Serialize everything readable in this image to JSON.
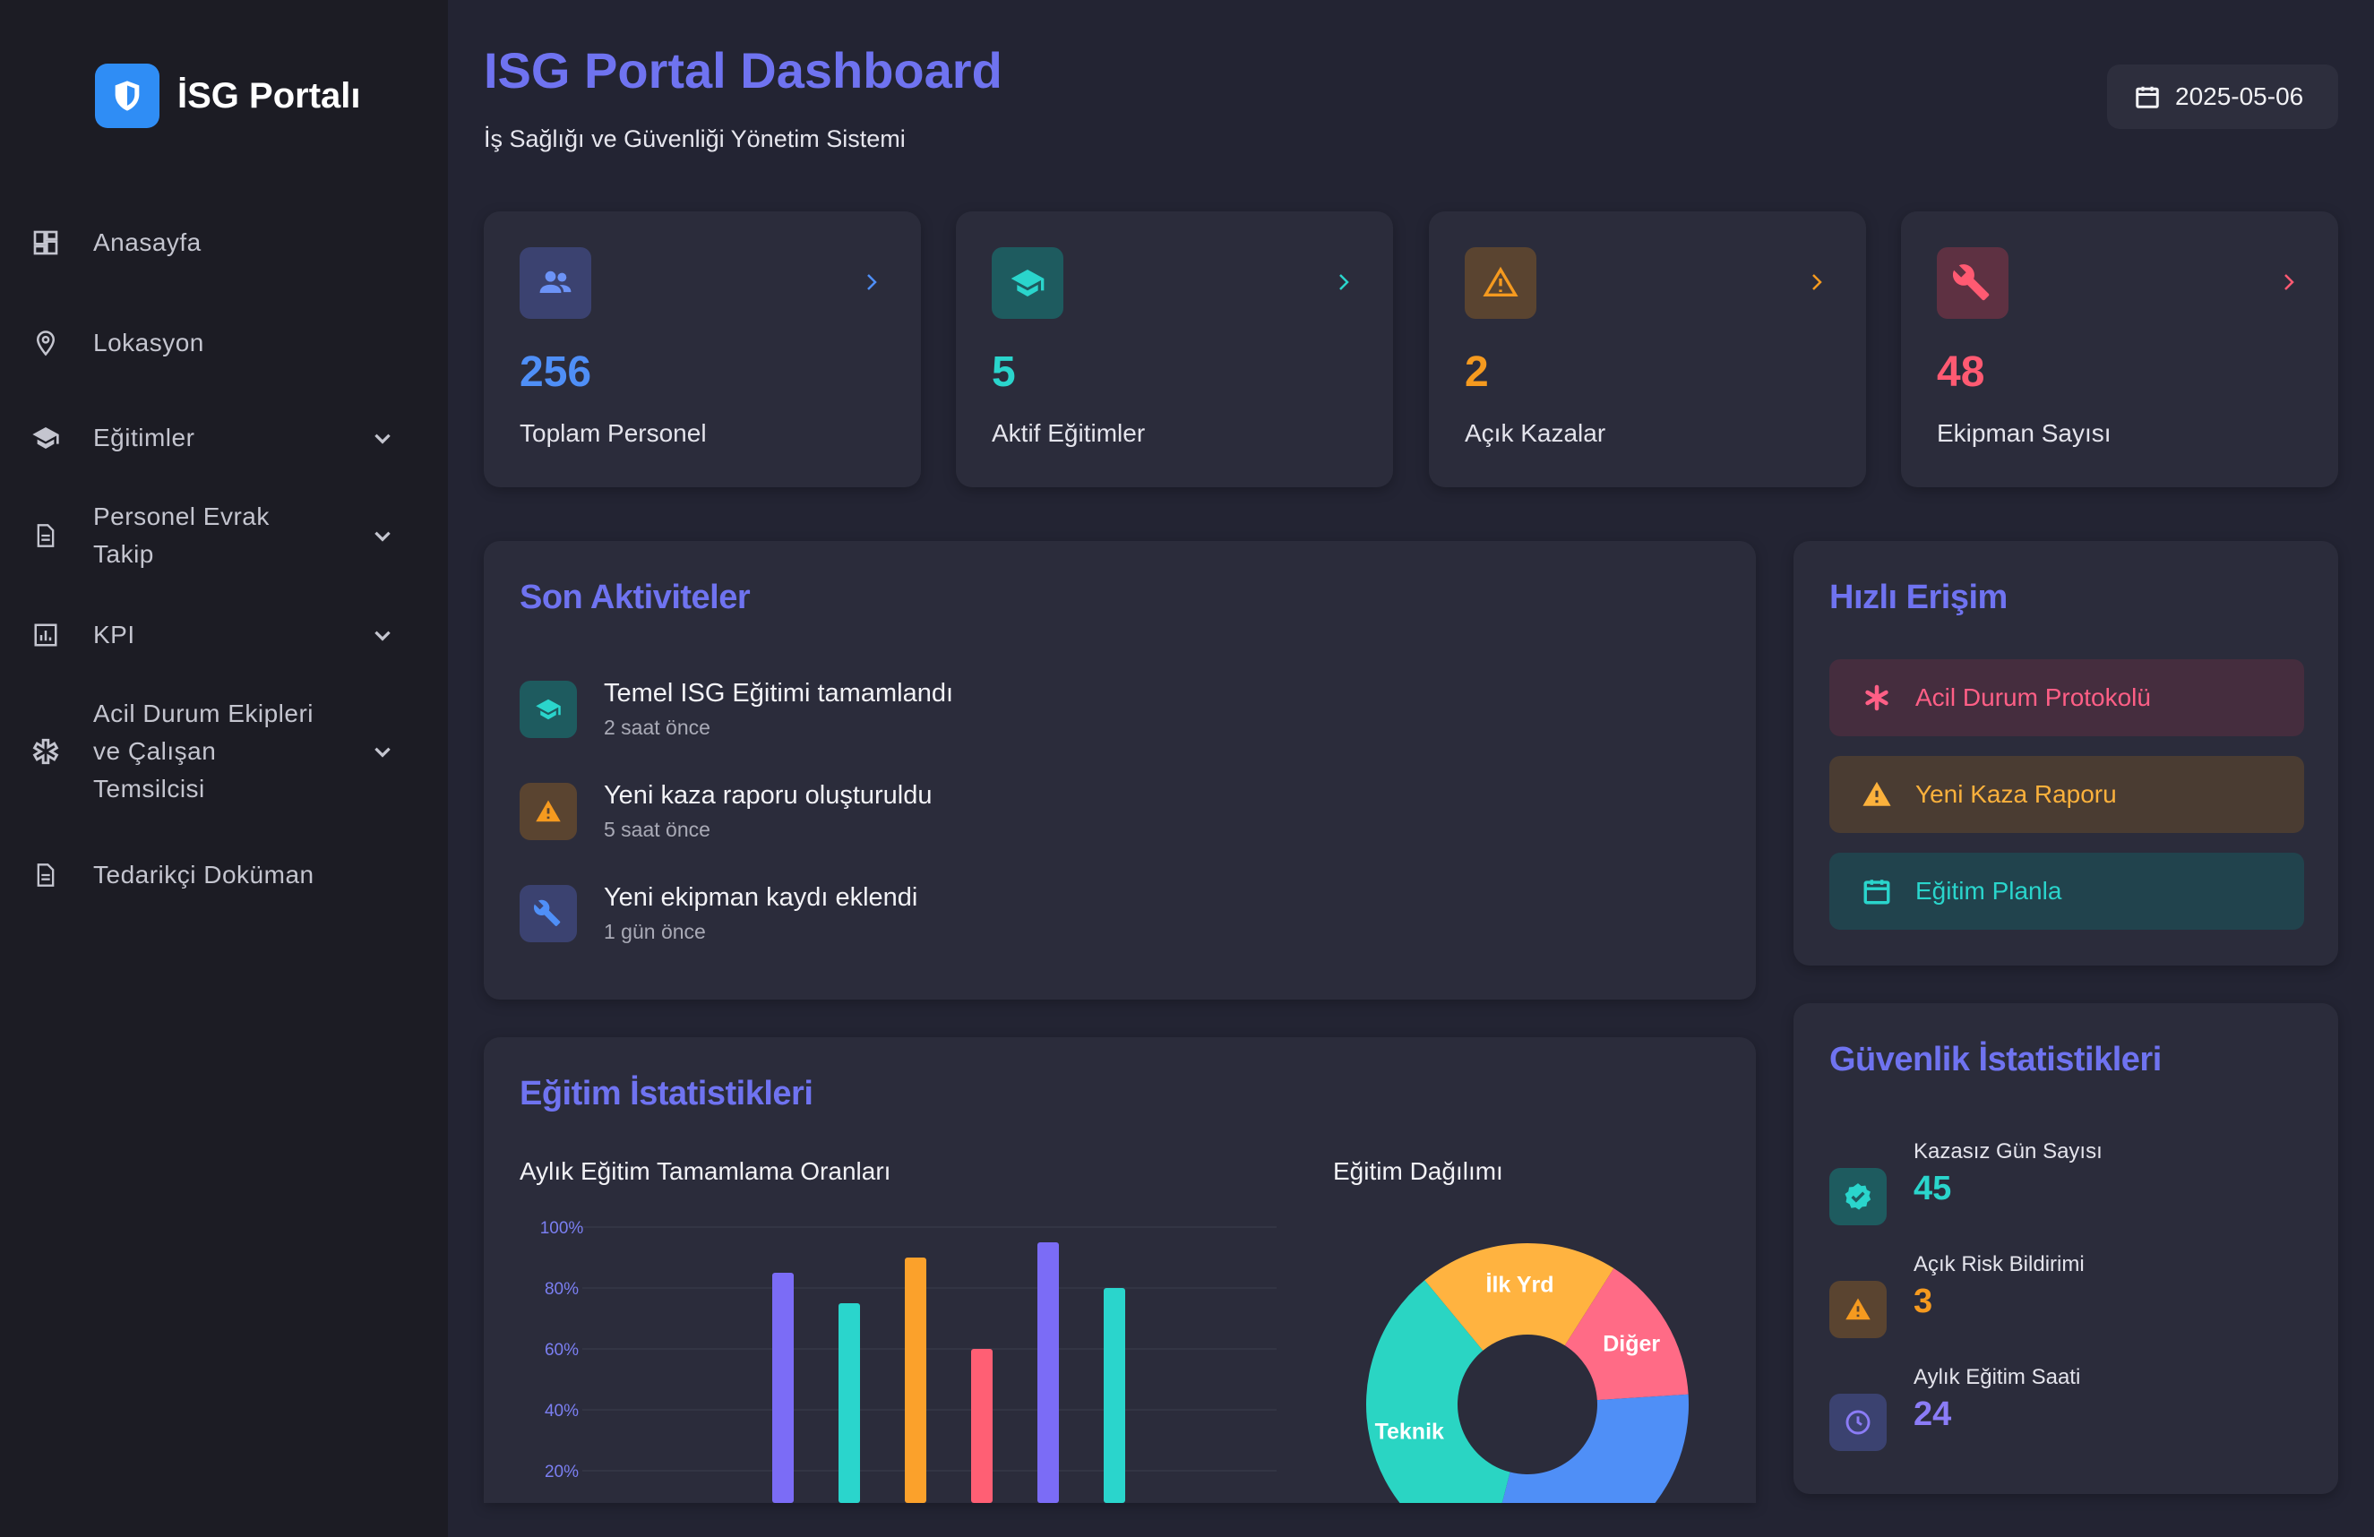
{
  "brand": {
    "name": "İSG Portalı"
  },
  "sidebar": {
    "items": [
      {
        "label": "Anasayfa"
      },
      {
        "label": "Lokasyon"
      },
      {
        "label": "Eğitimler"
      },
      {
        "label_1": "Personel Evrak",
        "label_2": "Takip"
      },
      {
        "label": "KPI"
      },
      {
        "label_1": "Acil Durum Ekipleri",
        "label_2": "ve Çalışan",
        "label_3": "Temsilcisi"
      },
      {
        "label": "Tedarikçi Doküman"
      }
    ]
  },
  "header": {
    "title": "ISG Portal Dashboard",
    "subtitle": "İş Sağlığı ve Güvenliği Yönetim Sistemi",
    "date": "2025-05-06"
  },
  "stats": [
    {
      "value": "256",
      "label": "Toplam Personel",
      "color": "#4f8ff7",
      "icon": "users-icon"
    },
    {
      "value": "5",
      "label": "Aktif Eğitimler",
      "color": "#2ad5cc",
      "icon": "graduation-cap-icon"
    },
    {
      "value": "2",
      "label": "Açık Kazalar",
      "color": "#f59a1f",
      "icon": "warning-icon"
    },
    {
      "value": "48",
      "label": "Ekipman Sayısı",
      "color": "#ff5a72",
      "icon": "wrench-icon"
    }
  ],
  "activities": {
    "title": "Son Aktiviteler",
    "items": [
      {
        "title": "Temel ISG Eğitimi tamamlandı",
        "time": "2 saat önce",
        "icon": "graduation-cap-icon"
      },
      {
        "title": "Yeni kaza raporu oluşturuldu",
        "time": "5 saat önce",
        "icon": "warning-icon"
      },
      {
        "title": "Yeni ekipman kaydı eklendi",
        "time": "1 gün önce",
        "icon": "wrench-icon"
      }
    ]
  },
  "quick_access": {
    "title": "Hızlı Erişim",
    "items": [
      {
        "label": "Acil Durum Protokolü",
        "color": "#ff5f86",
        "icon": "asterisk-icon"
      },
      {
        "label": "Yeni Kaza Raporu",
        "color": "#fbb13c",
        "icon": "warning-icon"
      },
      {
        "label": "Eğitim Planla",
        "color": "#2ad5cc",
        "icon": "calendar-icon"
      }
    ]
  },
  "training_stats": {
    "title": "Eğitim İstatistikleri",
    "bar_title": "Aylık Eğitim Tamamlama Oranları",
    "donut_title": "Eğitim Dağılımı"
  },
  "safety_stats": {
    "title": "Güvenlik İstatistikleri",
    "items": [
      {
        "label": "Kazasız Gün Sayısı",
        "value": "45",
        "color": "#2ad5cc",
        "icon": "verified-badge-icon"
      },
      {
        "label": "Açık Risk Bildirimi",
        "value": "3",
        "color": "#f59a1f",
        "icon": "warning-icon"
      },
      {
        "label": "Aylık Eğitim Saati",
        "value": "24",
        "color": "#8b7cf6",
        "icon": "clock-icon"
      }
    ]
  },
  "chart_data": [
    {
      "type": "bar",
      "title": "Aylık Eğitim Tamamlama Oranları",
      "y_ticks": [
        "100%",
        "80%",
        "60%",
        "40%",
        "20%"
      ],
      "ylim": [
        0,
        100
      ],
      "values": [
        85,
        75,
        90,
        60,
        95,
        80
      ],
      "colors": [
        "#7b6cf6",
        "#2ad5cc",
        "#fba12b",
        "#ff5f74",
        "#7b6cf6",
        "#2ad5cc"
      ],
      "grid": true
    },
    {
      "type": "pie",
      "title": "Eğitim Dağılımı",
      "slices": [
        {
          "label": "İlk Yrd",
          "value": 20,
          "color": "#ffb340"
        },
        {
          "label": "Diğer",
          "value": 15,
          "color": "#ff6b86"
        },
        {
          "label": "",
          "value": 30,
          "color": "#4f8ff7"
        },
        {
          "label": "Teknik",
          "value": 35,
          "color": "#2ad5c3"
        }
      ]
    }
  ]
}
